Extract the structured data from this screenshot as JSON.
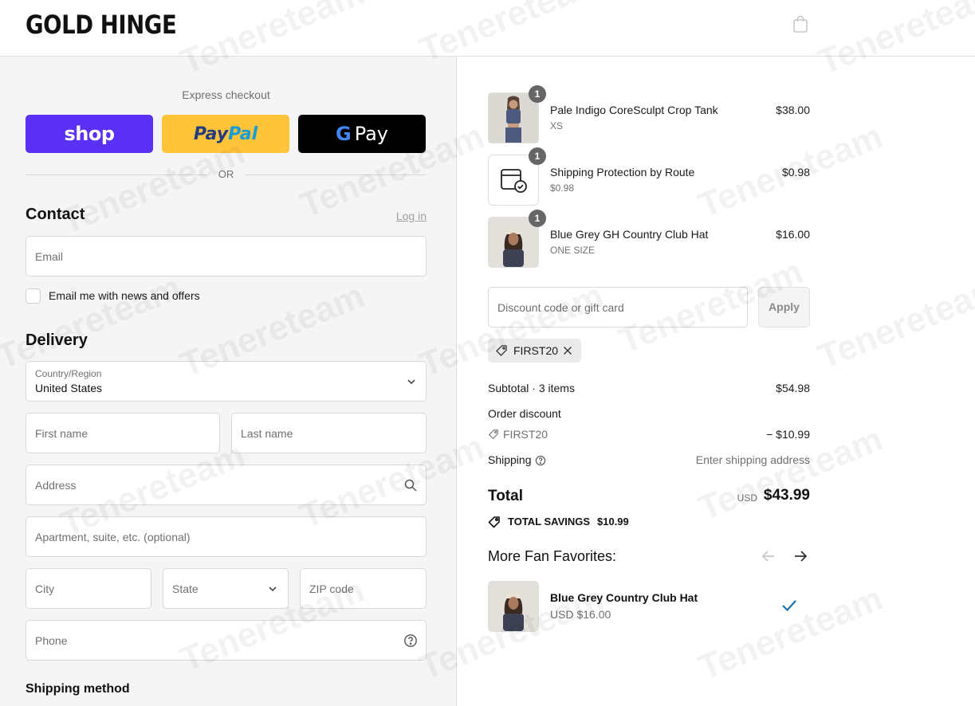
{
  "header": {
    "brand": "GOLD HINGE"
  },
  "express": {
    "label": "Express checkout",
    "shop_label": "shop",
    "paypal_label_1": "Pay",
    "paypal_label_2": "Pal",
    "gpay_g": "G",
    "gpay_label": "Pay",
    "or_label": "OR"
  },
  "contact": {
    "title": "Contact",
    "login_label": "Log in",
    "email_placeholder": "Email",
    "newsletter_label": "Email me with news and offers"
  },
  "delivery": {
    "title": "Delivery",
    "country_label": "Country/Region",
    "country_value": "United States",
    "first_name_placeholder": "First name",
    "last_name_placeholder": "Last name",
    "address_placeholder": "Address",
    "apartment_placeholder": "Apartment, suite, etc. (optional)",
    "city_placeholder": "City",
    "state_placeholder": "State",
    "zip_placeholder": "ZIP code",
    "phone_placeholder": "Phone"
  },
  "shipping_method": {
    "title": "Shipping method"
  },
  "cart": {
    "items": [
      {
        "qty": "1",
        "name": "Pale Indigo CoreSculpt Crop Tank",
        "variant": "XS",
        "price": "$38.00"
      },
      {
        "qty": "1",
        "name": "Shipping Protection by Route",
        "variant": "$0.98",
        "price": "$0.98"
      },
      {
        "qty": "1",
        "name": "Blue Grey GH Country Club Hat",
        "variant": "ONE SIZE",
        "price": "$16.00"
      }
    ],
    "discount_placeholder": "Discount code or gift card",
    "apply_label": "Apply",
    "applied_code": "FIRST20"
  },
  "summary": {
    "subtotal_label": "Subtotal · 3 items",
    "subtotal_value": "$54.98",
    "order_discount_label": "Order discount",
    "discount_code": "FIRST20",
    "discount_value": "− $10.99",
    "shipping_label": "Shipping",
    "shipping_value": "Enter shipping address",
    "total_label": "Total",
    "total_currency": "USD",
    "total_value": "$43.99",
    "savings_label": "TOTAL SAVINGS",
    "savings_value": "$10.99"
  },
  "favorites": {
    "title": "More Fan Favorites:",
    "item_name": "Blue Grey Country Club Hat",
    "item_price": "USD $16.00"
  },
  "colors": {
    "shop": "#5a31f4",
    "paypal": "#ffc439",
    "gpay": "#000000",
    "check_accent": "#1773b0"
  },
  "watermark": "Tenereteam"
}
